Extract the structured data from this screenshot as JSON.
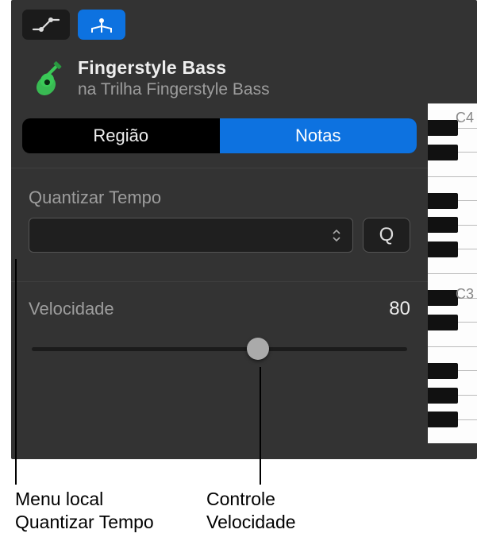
{
  "toolbar": {
    "automation_icon": "automation-curve",
    "midi_icon": "midi-merge"
  },
  "header": {
    "title": "Fingerstyle Bass",
    "subtitle": "na Trilha Fingerstyle Bass"
  },
  "segmented": {
    "region": "Região",
    "notes": "Notas"
  },
  "quantize": {
    "label": "Quantizar Tempo",
    "value": "",
    "q_button": "Q"
  },
  "velocity": {
    "label": "Velocidade",
    "value": "80",
    "percent": 60
  },
  "piano": {
    "labels": {
      "c4": "C4",
      "c3": "C3"
    }
  },
  "callouts": {
    "quantize_menu_l1": "Menu local",
    "quantize_menu_l2": "Quantizar Tempo",
    "velocity_l1": "Controle",
    "velocity_l2": "Velocidade"
  }
}
